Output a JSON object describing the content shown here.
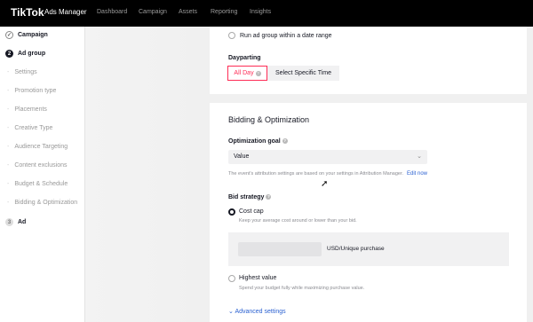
{
  "topbar": {
    "logo": "TikTok",
    "product": "Ads Manager",
    "nav": [
      "Dashboard",
      "Campaign",
      "Assets",
      "Reporting",
      "Insights"
    ]
  },
  "sidebar": {
    "steps": [
      {
        "num": "✓",
        "label": "Campaign",
        "state": "done"
      },
      {
        "num": "2",
        "label": "Ad group",
        "state": "active"
      },
      {
        "num": "3",
        "label": "Ad",
        "state": "pending"
      }
    ],
    "subitems": [
      "Settings",
      "Promotion type",
      "Placements",
      "Creative Type",
      "Audience Targeting",
      "Content exclusions",
      "Budget & Schedule",
      "Bidding & Optimization"
    ]
  },
  "schedule": {
    "radio_label": "Run ad group within a date range"
  },
  "dayparting": {
    "title": "Dayparting",
    "option_all": "All Day",
    "option_specific": "Select Specific Time"
  },
  "bidding": {
    "section_title": "Bidding & Optimization",
    "goal_label": "Optimization goal",
    "goal_value": "Value",
    "attribution_note": "The event's attribution settings are based on your settings in Attribution Manager.",
    "edit_link": "Edit now",
    "strategy_label": "Bid strategy",
    "cost_cap_label": "Cost cap",
    "cost_cap_desc": "Keep your average cost around or lower than your bid.",
    "cost_cap_unit": "USD/Unique purchase",
    "highest_value_label": "Highest value",
    "highest_value_desc": "Spend your budget fully while maximizing purchase value.",
    "advanced_link": "Advanced settings"
  },
  "colors": {
    "accent": "#fe2c55",
    "link": "#2b61d1",
    "topbar": "#000000"
  }
}
